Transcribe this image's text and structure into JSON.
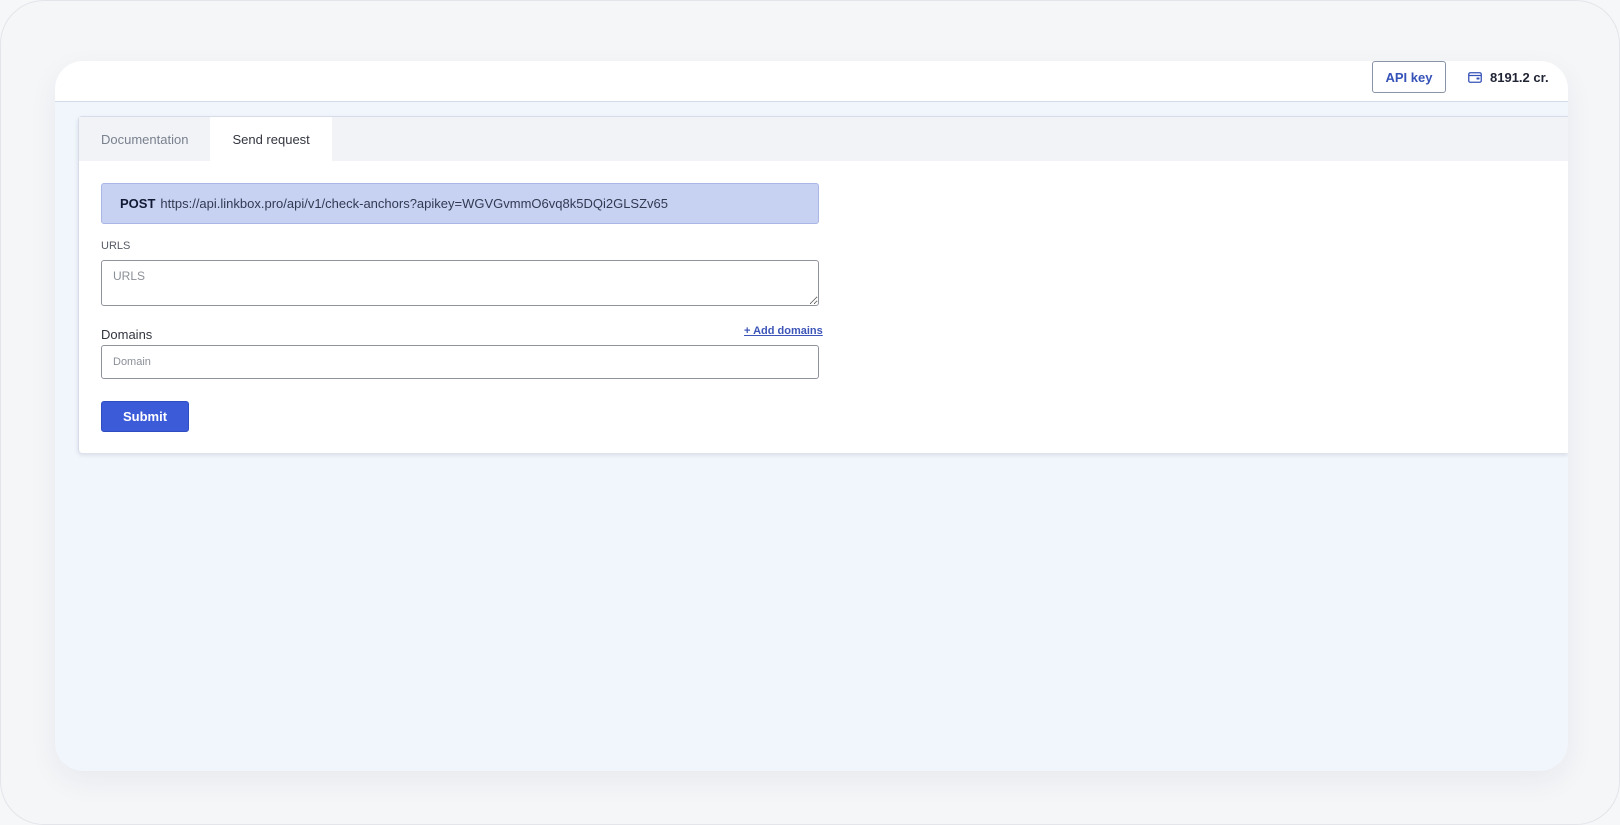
{
  "header": {
    "api_key_label": "API key",
    "credits_icon": "wallet-icon",
    "credits_value": "8191.2 cr."
  },
  "tabs": [
    {
      "label": "Documentation",
      "active": false
    },
    {
      "label": "Send request",
      "active": true
    }
  ],
  "endpoint": {
    "method": "POST",
    "url": "https://api.linkbox.pro/api/v1/check-anchors?apikey=WGVGvmmO6vq8k5DQi2GLSZv65"
  },
  "form": {
    "urls_label": "URLS",
    "urls_placeholder": "URLS",
    "urls_value": "",
    "domains_label": "Domains",
    "add_domains_label": "+ Add domains",
    "domain_placeholder": "Domain",
    "domain_value": "",
    "submit_label": "Submit"
  },
  "colors": {
    "accent": "#3b5bd9",
    "endpoint_bg": "#c7d2f3",
    "app_bg": "#f1f5fc"
  }
}
